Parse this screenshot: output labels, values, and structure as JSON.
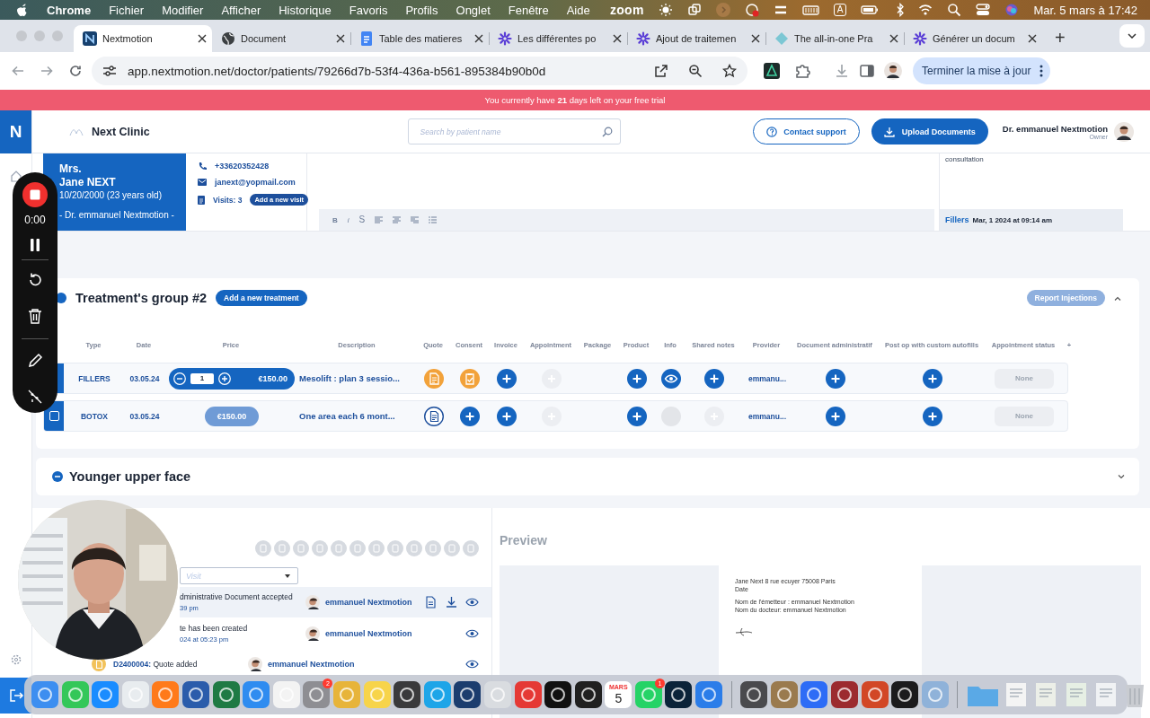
{
  "menubar": {
    "app": "Chrome",
    "menus": [
      "Fichier",
      "Modifier",
      "Afficher",
      "Historique",
      "Favoris",
      "Profils",
      "Onglet",
      "Fenêtre",
      "Aide"
    ],
    "zoom_label": "zoom",
    "input_source": "A",
    "clock": "Mar. 5 mars à 17:42"
  },
  "browser": {
    "tabs": [
      {
        "title": "Nextmotion",
        "kind": "nextmotion",
        "selected": true
      },
      {
        "title": "Document",
        "kind": "globe",
        "selected": false
      },
      {
        "title": "Table des matieres",
        "kind": "docs",
        "selected": false
      },
      {
        "title": "Les différentes po",
        "kind": "flower",
        "selected": false
      },
      {
        "title": "Ajout de traitemen",
        "kind": "flower",
        "selected": false
      },
      {
        "title": "The all-in-one Pra",
        "kind": "diamond",
        "selected": false
      },
      {
        "title": "Générer un docum",
        "kind": "flower",
        "selected": false
      }
    ],
    "new_tab": "+",
    "url": "app.nextmotion.net/doctor/patients/79266d7b-53f4-436a-b561-895384b90b0d",
    "update_button": "Terminer la mise à jour"
  },
  "trial_banner": "You currently have **21** days left on your free trial",
  "rail": {
    "logo": "N"
  },
  "header": {
    "clinic": "Next Clinic",
    "search_placeholder": "Search by patient name",
    "contact_button": "Contact support",
    "upload_button": "Upload Documents",
    "user": "Dr. emmanuel Nextmotion",
    "role": "Owner"
  },
  "patient": {
    "title": "Mrs.",
    "name": "Jane NEXT",
    "birth": "10/20/2000  (23 years old)",
    "doctor": "- Dr. emmanuel Nextmotion -",
    "phone": "+33620352428",
    "email": "janext@yopmail.com",
    "visits": "Visits: **3**",
    "add_visit": "Add a new visit"
  },
  "editor": {
    "format_buttons": [
      "B",
      "i",
      "S"
    ]
  },
  "last_note": {
    "text": "consultation",
    "type": "Fillers",
    "date": "Mar, 1 2024 at 09:14 am"
  },
  "treatments": {
    "title": "Treatment's group #2",
    "add_button": "Add a new treatment",
    "report_button": "Report Injections",
    "expanded": true,
    "columns": [
      "Type",
      "Date",
      "Price",
      "Description",
      "Quote",
      "Consent",
      "Invoice",
      "Appointment",
      "Package",
      "Product",
      "Info",
      "Shared notes",
      "Provider",
      "Document administratif",
      "Post op with custom autofills",
      "Appointment status",
      "+"
    ],
    "rows": [
      {
        "type": "FILLERS",
        "date": "03.05.24",
        "price": {
          "kind": "stepper",
          "quantity": "1",
          "amount": "€150.00"
        },
        "description": "Mesolift : plan 3 sessio...",
        "cells": [
          {
            "kind": "quote_orange"
          },
          {
            "kind": "consent_orange"
          },
          {
            "kind": "add"
          },
          {
            "kind": "add_disabled"
          },
          {
            "kind": "empty"
          },
          {
            "kind": "add"
          },
          {
            "kind": "eye"
          },
          {
            "kind": "add"
          },
          {
            "kind": "text",
            "text": "emmanu..."
          },
          {
            "kind": "add"
          },
          {
            "kind": "add"
          },
          {
            "kind": "status",
            "text": "None"
          }
        ]
      },
      {
        "selected": false,
        "type": "BOTOX",
        "date": "03.05.24",
        "price": {
          "kind": "pill",
          "amount": "€150.00"
        },
        "description": "One area each 6 mont...",
        "cells": [
          {
            "kind": "quote_blue"
          },
          {
            "kind": "add"
          },
          {
            "kind": "add"
          },
          {
            "kind": "add_disabled"
          },
          {
            "kind": "empty"
          },
          {
            "kind": "add"
          },
          {
            "kind": "disabled"
          },
          {
            "kind": "add_disabled"
          },
          {
            "kind": "text",
            "text": "emmanu..."
          },
          {
            "kind": "add"
          },
          {
            "kind": "add"
          },
          {
            "kind": "status",
            "text": "None"
          }
        ]
      }
    ]
  },
  "younger": {
    "title": "Younger upper face",
    "expanded": false
  },
  "documents": {
    "visit_placeholder": "Visit",
    "preview_title": "Preview",
    "activity": [
      {
        "kind": "accepted",
        "text": "dministrative Document accepted",
        "time": "39 pm",
        "user": "emmanuel Nextmotion",
        "selected": true
      },
      {
        "kind": "created",
        "text": "te has been created",
        "time": "024 at 05:23 pm",
        "user": "emmanuel Nextmotion",
        "selected": false
      },
      {
        "kind": "quote",
        "text": "**D2400004:** Quote added",
        "user": "emmanuel Nextmotion",
        "selected": false
      }
    ],
    "preview_lines": [
      "Jane Next 8 rue ecuyer 75008 Paris",
      "Date",
      "Nom de l'émetteur : emmanuel Nextmotion",
      "Nom du docteur: emmanuel Nextmotion"
    ]
  },
  "recorder": {
    "time": "0:00"
  },
  "dock": {
    "items": [
      {
        "kind": "app",
        "color": "#3d8ef0"
      },
      {
        "kind": "app",
        "color": "#34c759"
      },
      {
        "kind": "app",
        "color": "#1a8cff"
      },
      {
        "kind": "app",
        "color": "#e8ecef"
      },
      {
        "kind": "app",
        "color": "#ff7a1a"
      },
      {
        "kind": "app",
        "color": "#2b5cab"
      },
      {
        "kind": "app",
        "color": "#1f7a44"
      },
      {
        "kind": "app",
        "color": "#2f8cf0"
      },
      {
        "kind": "app",
        "color": "#f3f3f3"
      },
      {
        "kind": "app",
        "color": "#8e8e93",
        "badge": "2"
      },
      {
        "kind": "app",
        "color": "#e7b43a"
      },
      {
        "kind": "app",
        "color": "#f7d44a"
      },
      {
        "kind": "app",
        "color": "#3a3a3c"
      },
      {
        "kind": "app",
        "color": "#1ea5e8"
      },
      {
        "kind": "app",
        "color": "#1c3d6e"
      },
      {
        "kind": "app",
        "color": "#d9dce0"
      },
      {
        "kind": "app",
        "color": "#e53935"
      },
      {
        "kind": "app",
        "color": "#111111"
      },
      {
        "kind": "app",
        "color": "#202020"
      },
      {
        "kind": "calendar",
        "month": "MARS",
        "day": "5"
      },
      {
        "kind": "app",
        "color": "#25d366",
        "badge": "1"
      },
      {
        "kind": "app",
        "color": "#0b2339"
      },
      {
        "kind": "app",
        "color": "#2b7de9"
      },
      {
        "kind": "separator"
      },
      {
        "kind": "app",
        "color": "#4a4a4d"
      },
      {
        "kind": "app",
        "color": "#9a7a4e"
      },
      {
        "kind": "app",
        "color": "#2d6cf6"
      },
      {
        "kind": "app",
        "color": "#9c2b2f"
      },
      {
        "kind": "app",
        "color": "#d24726"
      },
      {
        "kind": "app",
        "color": "#1b1b1d"
      },
      {
        "kind": "app",
        "color": "#8fb2d9"
      },
      {
        "kind": "separator"
      },
      {
        "kind": "folder",
        "color": "#5aa9e6"
      },
      {
        "kind": "file",
        "color": "#f4f4f4"
      },
      {
        "kind": "file",
        "color": "#ecefe8"
      },
      {
        "kind": "file",
        "color": "#e6efe4"
      },
      {
        "kind": "file",
        "color": "#f0f2f4"
      },
      {
        "kind": "trash",
        "color": "#c9ccd1"
      }
    ]
  }
}
